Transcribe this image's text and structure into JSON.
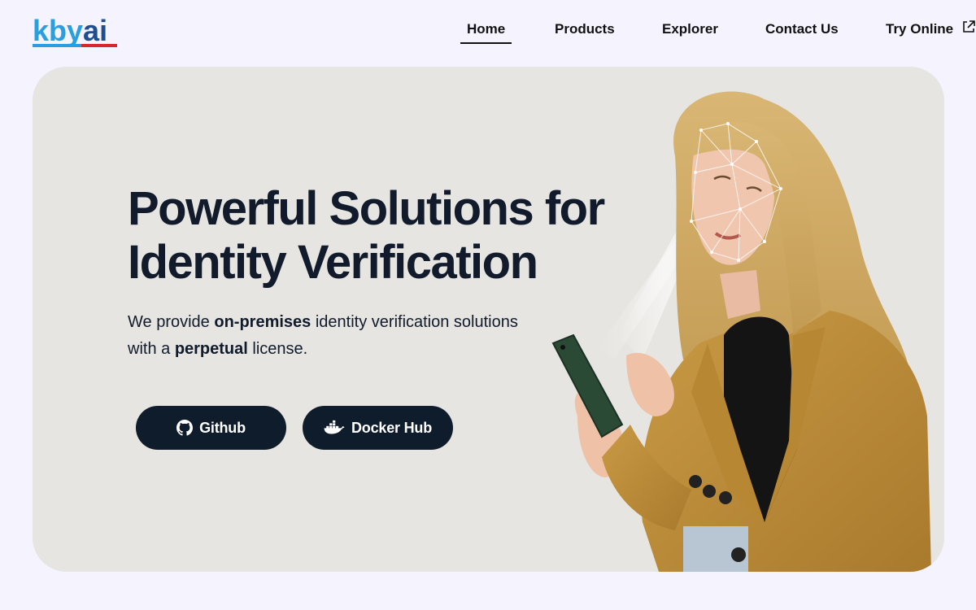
{
  "header": {
    "logo_text_part1": "kby",
    "logo_text_part2": "ai",
    "nav": [
      {
        "label": "Home",
        "active": true
      },
      {
        "label": "Products"
      },
      {
        "label": "Explorer"
      },
      {
        "label": "Contact Us"
      },
      {
        "label": "Try Online",
        "icon": "external-link-icon"
      }
    ]
  },
  "hero": {
    "headline_line1": "Powerful Solutions for",
    "headline_line2": "Identity Verification",
    "sub_line1_pre": "We provide ",
    "sub_line1_bold": "on-premises",
    "sub_line1_post": " identity verification solutions",
    "sub_line2_pre": "with a ",
    "sub_line2_bold": "perpetual",
    "sub_line2_post": " license.",
    "buttons": [
      {
        "label": "Github",
        "icon": "github-icon"
      },
      {
        "label": "Docker Hub",
        "icon": "docker-icon"
      }
    ]
  },
  "colors": {
    "page_bg": "#f5f3fd",
    "hero_bg": "#e6e5e1",
    "button_bg": "#0f1c2c",
    "logo_blue": "#2a9fe0",
    "logo_navy": "#1d4f91",
    "logo_red": "#d8262e"
  }
}
